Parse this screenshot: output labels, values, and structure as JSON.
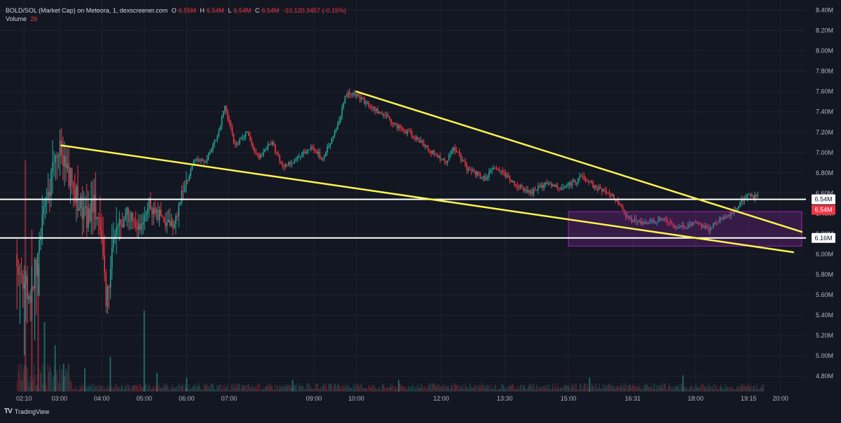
{
  "header": {
    "symbol": "BOLD/SOL (Market Cap) on Meteora, 1, dexscreener.com",
    "o_label": "O",
    "o_value": "6.55M",
    "h_label": "H",
    "h_value": "6.54M",
    "l_label": "L",
    "l_value": "6.54M",
    "c_label": "C",
    "c_value": "6.54M",
    "change": "-10,120.3457 (-0.15%)",
    "volume_label": "Volume",
    "volume_value": "26"
  },
  "brand": {
    "logo_glyph": "TV",
    "name": "TradingView"
  },
  "colors": {
    "background": "#131722",
    "grid": "#1e222d",
    "text": "#b2b5be",
    "up": "#26a69a",
    "down": "#f23645",
    "trendline": "#fff44f",
    "level_line": "#ffffff",
    "zone_border": "#9c27b0",
    "zone_fill": "rgba(156,39,176,0.25)"
  },
  "chart_data": {
    "type": "candlestick",
    "y_axis": {
      "range": [
        4.65,
        8.5
      ],
      "ticks": [
        "4.80M",
        "5.00M",
        "5.20M",
        "5.40M",
        "5.60M",
        "5.80M",
        "6.00M",
        "6.20M",
        "6.40M",
        "6.60M",
        "6.80M",
        "7.00M",
        "7.20M",
        "7.40M",
        "7.60M",
        "7.80M",
        "8.00M",
        "8.20M",
        "8.40M"
      ],
      "tick_values": [
        4.8,
        5.0,
        5.2,
        5.4,
        5.6,
        5.8,
        6.0,
        6.2,
        6.4,
        6.6,
        6.8,
        7.0,
        7.2,
        7.4,
        7.6,
        7.8,
        8.0,
        8.2,
        8.4
      ]
    },
    "x_axis": {
      "range_hours": [
        1.6,
        20.6
      ],
      "ticks": [
        {
          "label": "02:10",
          "hour": 2.1667
        },
        {
          "label": "03:00",
          "hour": 3.0
        },
        {
          "label": "04:00",
          "hour": 4.0
        },
        {
          "label": "05:00",
          "hour": 5.0
        },
        {
          "label": "06:00",
          "hour": 6.0
        },
        {
          "label": "07:00",
          "hour": 7.0
        },
        {
          "label": "09:00",
          "hour": 9.0
        },
        {
          "label": "10:00",
          "hour": 10.0
        },
        {
          "label": "12:00",
          "hour": 12.0
        },
        {
          "label": "13:30",
          "hour": 13.5
        },
        {
          "label": "15:00",
          "hour": 15.0
        },
        {
          "label": "16:31",
          "hour": 16.5167
        },
        {
          "label": "18:00",
          "hour": 18.0
        },
        {
          "label": "19:15",
          "hour": 19.25
        },
        {
          "label": "20:00",
          "hour": 20.0
        }
      ]
    },
    "price_path": [
      [
        2.0,
        6.0
      ],
      [
        2.3,
        5.5
      ],
      [
        2.6,
        6.3
      ],
      [
        2.85,
        6.9
      ],
      [
        3.05,
        7.05
      ],
      [
        3.3,
        6.7
      ],
      [
        3.6,
        6.35
      ],
      [
        3.9,
        6.5
      ],
      [
        4.1,
        5.55
      ],
      [
        4.3,
        6.2
      ],
      [
        4.6,
        6.4
      ],
      [
        4.9,
        6.25
      ],
      [
        5.1,
        6.5
      ],
      [
        5.4,
        6.35
      ],
      [
        5.7,
        6.3
      ],
      [
        5.95,
        6.65
      ],
      [
        6.2,
        6.95
      ],
      [
        6.45,
        6.9
      ],
      [
        6.75,
        7.2
      ],
      [
        6.9,
        7.45
      ],
      [
        7.15,
        7.05
      ],
      [
        7.4,
        7.2
      ],
      [
        7.7,
        6.95
      ],
      [
        8.0,
        7.1
      ],
      [
        8.3,
        6.85
      ],
      [
        8.6,
        6.95
      ],
      [
        8.9,
        7.05
      ],
      [
        9.2,
        6.95
      ],
      [
        9.5,
        7.2
      ],
      [
        9.75,
        7.55
      ],
      [
        9.9,
        7.6
      ],
      [
        10.2,
        7.5
      ],
      [
        10.6,
        7.38
      ],
      [
        11.0,
        7.25
      ],
      [
        11.4,
        7.15
      ],
      [
        11.8,
        7.0
      ],
      [
        12.1,
        6.9
      ],
      [
        12.3,
        7.05
      ],
      [
        12.6,
        6.85
      ],
      [
        13.0,
        6.75
      ],
      [
        13.3,
        6.85
      ],
      [
        13.7,
        6.7
      ],
      [
        14.1,
        6.6
      ],
      [
        14.5,
        6.7
      ],
      [
        14.9,
        6.65
      ],
      [
        15.3,
        6.75
      ],
      [
        15.7,
        6.65
      ],
      [
        16.1,
        6.55
      ],
      [
        16.4,
        6.35
      ],
      [
        16.8,
        6.3
      ],
      [
        17.2,
        6.35
      ],
      [
        17.6,
        6.25
      ],
      [
        18.0,
        6.3
      ],
      [
        18.3,
        6.25
      ],
      [
        18.6,
        6.35
      ],
      [
        18.9,
        6.42
      ],
      [
        19.2,
        6.58
      ],
      [
        19.5,
        6.55
      ]
    ],
    "volume_spikes": [
      {
        "hour": 2.2,
        "height": 1.0
      },
      {
        "hour": 2.35,
        "height": 0.7
      },
      {
        "hour": 2.5,
        "height": 0.55
      },
      {
        "hour": 2.65,
        "height": 0.3
      },
      {
        "hour": 2.9,
        "height": 0.2
      },
      {
        "hour": 3.1,
        "height": 0.12
      },
      {
        "hour": 3.6,
        "height": 0.1
      },
      {
        "hour": 4.2,
        "height": 0.15
      },
      {
        "hour": 5.0,
        "height": 0.35
      },
      {
        "hour": 5.3,
        "height": 0.08
      },
      {
        "hour": 6.0,
        "height": 0.06
      },
      {
        "hour": 8.5,
        "height": 0.05
      },
      {
        "hour": 11.0,
        "height": 0.05
      },
      {
        "hour": 15.5,
        "height": 0.06
      },
      {
        "hour": 17.7,
        "height": 0.07
      }
    ],
    "annotations": {
      "horizontal_levels": [
        {
          "value": 6.54,
          "label": "6.54M",
          "badge_text": "6.54M"
        },
        {
          "value": 6.16,
          "label": "6.16M"
        }
      ],
      "trendlines": [
        {
          "from": [
            3.05,
            7.07
          ],
          "to": [
            20.3,
            6.02
          ]
        },
        {
          "from": [
            10.0,
            7.6
          ],
          "to": [
            20.5,
            6.22
          ]
        }
      ],
      "zone": {
        "from_hour": 15.0,
        "to_hour": 20.5,
        "top": 6.42,
        "bottom": 6.08
      }
    }
  }
}
